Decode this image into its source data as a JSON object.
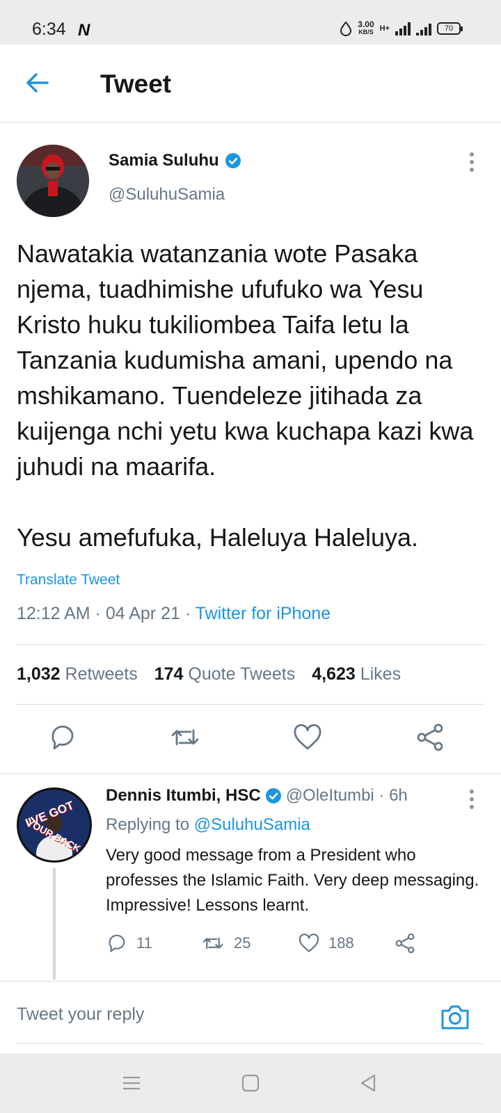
{
  "status_bar": {
    "time": "6:34",
    "notification": "N",
    "speed_value": "3.00",
    "speed_unit": "KB/S",
    "network": "H+",
    "battery": "70"
  },
  "header": {
    "title": "Tweet"
  },
  "tweet": {
    "author_name": "Samia Suluhu",
    "author_handle": "@SuluhuSamia",
    "verified": true,
    "text": "Nawatakia watanzania wote Pasaka njema, tuadhimishe ufufuko wa Yesu Kristo huku tukiliombea Taifa letu la Tanzania kudumisha amani, upendo na mshikamano. Tuendeleze jitihada za kuijenga nchi yetu kwa kuchapa kazi kwa juhudi na maarifa.\n\nYesu amefufuka, Haleluya Haleluya.",
    "translate_label": "Translate Tweet",
    "timestamp": "12:12 AM · 04 Apr 21 · ",
    "source": "Twitter for iPhone",
    "retweets_count": "1,032",
    "retweets_label": "Retweets",
    "quotes_count": "174",
    "quotes_label": "Quote Tweets",
    "likes_count": "4,623",
    "likes_label": "Likes"
  },
  "reply": {
    "author_name": "Dennis Itumbi, HSC",
    "author_handle": "@OleItumbi · 6h",
    "replying_prefix": "Replying to ",
    "replying_to": "@SuluhuSamia",
    "text": "Very good message from a President who professes the Islamic Faith. Very deep messaging. Impressive! Lessons learnt.",
    "reply_count": "11",
    "retweet_count": "25",
    "like_count": "188",
    "avatar_text_top": "I'VE GOT",
    "avatar_text_bottom": "YOUR BACK"
  },
  "composer": {
    "placeholder": "Tweet your reply"
  },
  "colors": {
    "accent": "#1b95e0",
    "muted": "#657786",
    "text": "#14171a"
  }
}
